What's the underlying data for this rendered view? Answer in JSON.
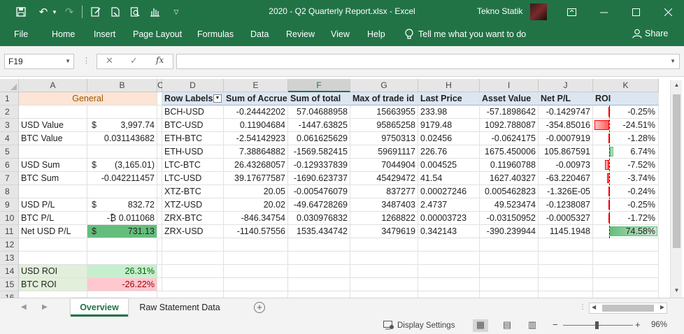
{
  "window": {
    "title": "2020 - Q2 Quarterly Report.xlsx  -  Excel",
    "user": "Tekno Statik"
  },
  "ribbon": {
    "tabs": [
      "File",
      "Home",
      "Insert",
      "Page Layout",
      "Formulas",
      "Data",
      "Review",
      "View",
      "Help"
    ],
    "tell_me": "Tell me what you want to do",
    "share": "Share"
  },
  "formula_bar": {
    "name_box": "F19",
    "fx": "fx",
    "formula": ""
  },
  "columns": [
    "A",
    "B",
    "C",
    "D",
    "E",
    "F",
    "G",
    "H",
    "I",
    "J",
    "K"
  ],
  "selected_column": "F",
  "rows": [
    "1",
    "2",
    "3",
    "4",
    "5",
    "6",
    "7",
    "8",
    "9",
    "10",
    "11",
    "12",
    "13",
    "14",
    "15",
    "16"
  ],
  "summary": {
    "header": "General",
    "rows": [
      {
        "label": "",
        "cur": "",
        "value": ""
      },
      {
        "label": "USD Value",
        "cur": "$",
        "value": "3,997.74"
      },
      {
        "label": "BTC Value",
        "cur": "",
        "value": "0.031143682"
      },
      {
        "label": "",
        "cur": "",
        "value": ""
      },
      {
        "label": "USD Sum",
        "cur": "$",
        "value": "(3,165.01)"
      },
      {
        "label": "BTC Sum",
        "cur": "",
        "value": "-0.042211457"
      },
      {
        "label": "",
        "cur": "",
        "value": ""
      },
      {
        "label": "USD P/L",
        "cur": "$",
        "value": "832.72"
      },
      {
        "label": "BTC P/L",
        "cur": "",
        "value": "-₿ 0.011068"
      },
      {
        "label": "Net USD P/L",
        "cur": "$",
        "value": "731.13"
      },
      {
        "label": "",
        "cur": "",
        "value": ""
      },
      {
        "label": "",
        "cur": "",
        "value": ""
      },
      {
        "label": "USD ROI",
        "cur": "",
        "value": "26.31%"
      },
      {
        "label": "BTC ROI",
        "cur": "",
        "value": "-26.22%"
      }
    ]
  },
  "pivot": {
    "headers": [
      "Row Labels",
      "Sum of Accrue",
      "Sum of total",
      "Max of trade id",
      "Last Price",
      "Asset Value",
      "Net P/L",
      "ROI"
    ],
    "rows": [
      {
        "label": "BCH-USD",
        "accrue": "-0.24442202",
        "total": "57.04688958",
        "trade_id": "15663955",
        "price": "233.98",
        "asset": "-57.1898642",
        "pl": "-0.1429747",
        "roi": "-0.25%",
        "roi_val": -0.25
      },
      {
        "label": "BTC-USD",
        "accrue": "0.11904684",
        "total": "-1447.63825",
        "trade_id": "95865258",
        "price": "9179.48",
        "asset": "1092.788087",
        "pl": "-354.85016",
        "roi": "-24.51%",
        "roi_val": -24.51
      },
      {
        "label": "ETH-BTC",
        "accrue": "-2.54142923",
        "total": "0.061625629",
        "trade_id": "9750313",
        "price": "0.02456",
        "asset": "-0.0624175",
        "pl": "-0.0007919",
        "roi": "-1.28%",
        "roi_val": -1.28
      },
      {
        "label": "ETH-USD",
        "accrue": "7.38864882",
        "total": "-1569.582415",
        "trade_id": "59691117",
        "price": "226.76",
        "asset": "1675.450006",
        "pl": "105.867591",
        "roi": "6.74%",
        "roi_val": 6.74
      },
      {
        "label": "LTC-BTC",
        "accrue": "26.43268057",
        "total": "-0.129337839",
        "trade_id": "7044904",
        "price": "0.004525",
        "asset": "0.11960788",
        "pl": "-0.00973",
        "roi": "-7.52%",
        "roi_val": -7.52
      },
      {
        "label": "LTC-USD",
        "accrue": "39.17677587",
        "total": "-1690.623737",
        "trade_id": "45429472",
        "price": "41.54",
        "asset": "1627.40327",
        "pl": "-63.220467",
        "roi": "-3.74%",
        "roi_val": -3.74
      },
      {
        "label": "XTZ-BTC",
        "accrue": "20.05",
        "total": "-0.005476079",
        "trade_id": "837277",
        "price": "0.00027246",
        "asset": "0.005462823",
        "pl": "-1.326E-05",
        "roi": "-0.24%",
        "roi_val": -0.24
      },
      {
        "label": "XTZ-USD",
        "accrue": "20.02",
        "total": "-49.64728269",
        "trade_id": "3487403",
        "price": "2.4737",
        "asset": "49.523474",
        "pl": "-0.1238087",
        "roi": "-0.25%",
        "roi_val": -0.25
      },
      {
        "label": "ZRX-BTC",
        "accrue": "-846.34754",
        "total": "0.030976832",
        "trade_id": "1268822",
        "price": "0.00003723",
        "asset": "-0.03150952",
        "pl": "-0.0005327",
        "roi": "-1.72%",
        "roi_val": -1.72
      },
      {
        "label": "ZRX-USD",
        "accrue": "-1140.57556",
        "total": "1535.434742",
        "trade_id": "3479619",
        "price": "0.342143",
        "asset": "-390.239944",
        "pl": "1145.1948",
        "roi": "74.58%",
        "roi_val": 74.58
      }
    ]
  },
  "sheets": {
    "tabs": [
      "Overview",
      "Raw Statement Data"
    ],
    "active": "Overview"
  },
  "status": {
    "display_settings": "Display Settings",
    "zoom": "96%"
  },
  "colors": {
    "accent": "#217346",
    "general_fill": "#fce4d6",
    "positive_fill": "#63be7b",
    "negative_bar": "#ff5a5a"
  }
}
